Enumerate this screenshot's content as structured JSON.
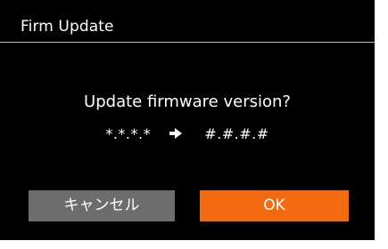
{
  "dialog": {
    "title": "Firm Update",
    "question": "Update firmware version?",
    "current_version": "*.*.*.*",
    "new_version": "#.#.#.#",
    "arrow_icon": "arrow-right-icon"
  },
  "buttons": {
    "cancel_label": "キャンセル",
    "ok_label": "OK"
  },
  "colors": {
    "background": "#000000",
    "ok_button": "#f26a10",
    "cancel_button": "#6d6d6d",
    "text": "#ffffff"
  }
}
